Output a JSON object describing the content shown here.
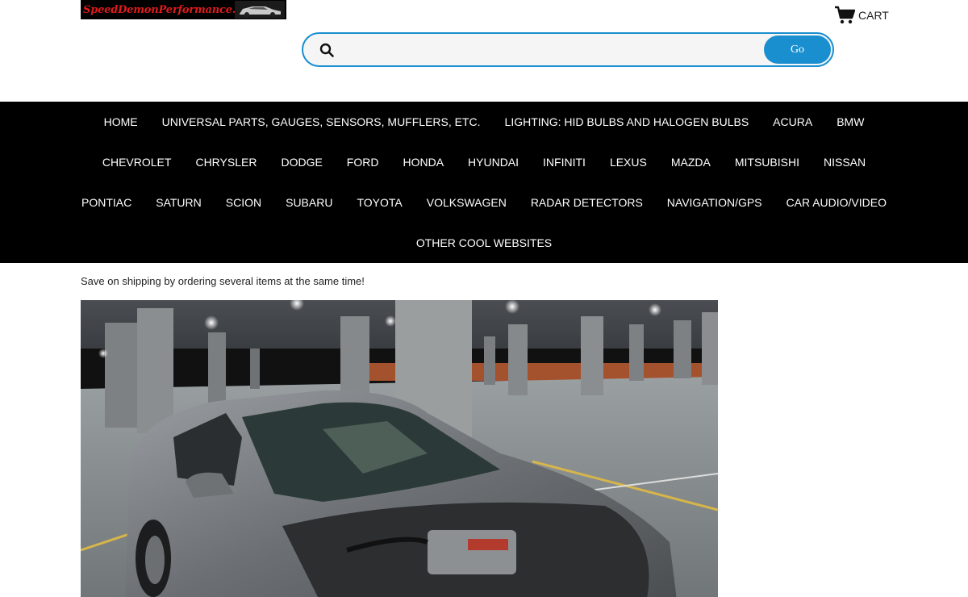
{
  "logo": {
    "text": "SpeedDemonPerformance.com"
  },
  "header": {
    "cart_label": "CART"
  },
  "search": {
    "placeholder": "",
    "value": "",
    "go_label": "Go"
  },
  "nav": {
    "rows": [
      [
        "HOME",
        "UNIVERSAL PARTS, GAUGES, SENSORS, MUFFLERS, ETC.",
        "LIGHTING: HID BULBS AND HALOGEN BULBS",
        "ACURA",
        "BMW"
      ],
      [
        "CHEVROLET",
        "CHRYSLER",
        "DODGE",
        "FORD",
        "HONDA",
        "HYUNDAI",
        "INFINITI",
        "LEXUS",
        "MAZDA",
        "MITSUBISHI",
        "NISSAN"
      ],
      [
        "PONTIAC",
        "SATURN",
        "SCION",
        "SUBARU",
        "TOYOTA",
        "VOLKSWAGEN",
        "RADAR DETECTORS",
        "NAVIGATION/GPS",
        "CAR AUDIO/VIDEO"
      ],
      [
        "OTHER COOL WEBSITES"
      ]
    ]
  },
  "main": {
    "note": "Save on shipping by ordering several items at the same time!"
  },
  "colors": {
    "accent": "#1a8fd0",
    "nav_bg": "#000000",
    "logo_text": "#e01b1b"
  },
  "icons": {
    "cart": "cart-icon",
    "search": "search-icon"
  }
}
